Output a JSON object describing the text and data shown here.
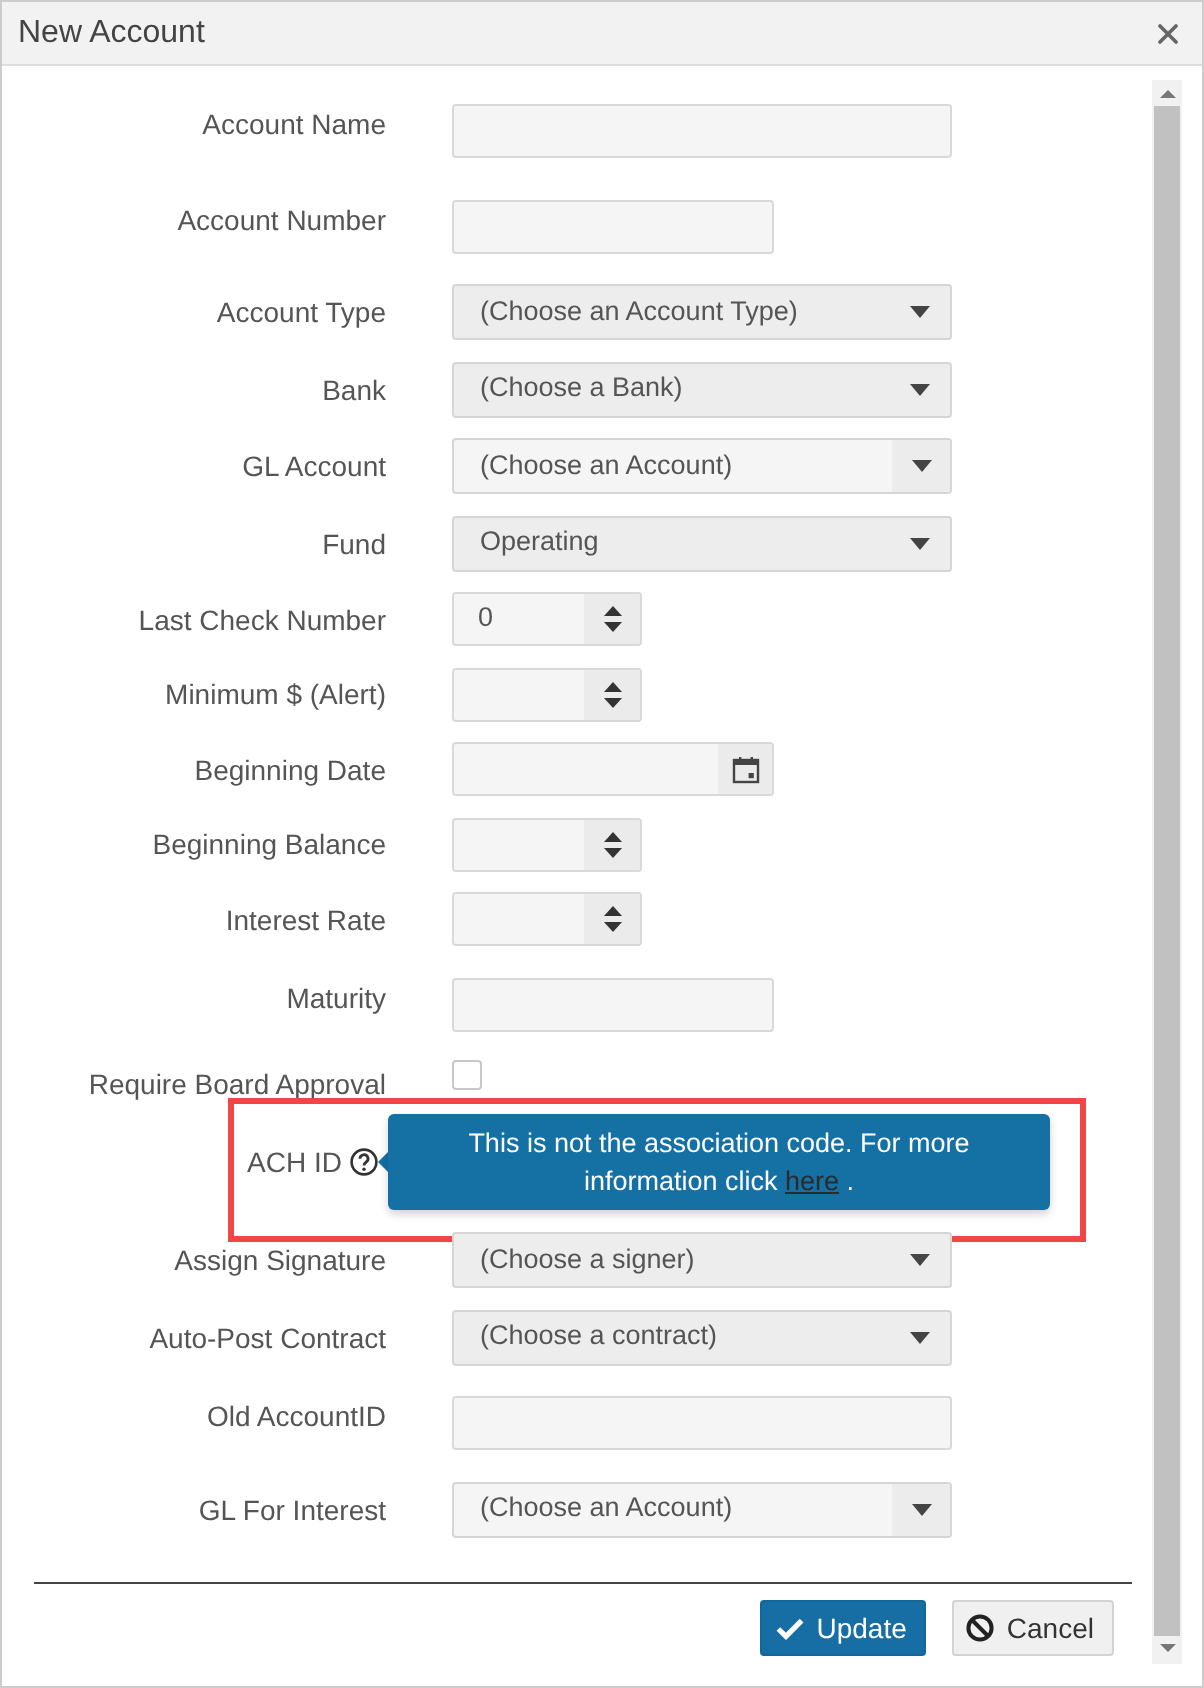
{
  "dialog": {
    "title": "New Account"
  },
  "fields": [
    {
      "label": "Account Name",
      "kind": "text"
    },
    {
      "label": "Account Number",
      "kind": "short-text"
    },
    {
      "label": "Account Type",
      "kind": "select",
      "value": "(Choose an Account Type)"
    },
    {
      "label": "Bank",
      "kind": "select",
      "value": "(Choose a Bank)"
    },
    {
      "label": "GL Account",
      "kind": "combo",
      "value": "(Choose an Account)"
    },
    {
      "label": "Fund",
      "kind": "select",
      "value": "Operating"
    },
    {
      "label": "Last Check Number",
      "kind": "number",
      "value": "0"
    },
    {
      "label": "Minimum $ (Alert)",
      "kind": "number"
    },
    {
      "label": "Beginning Date",
      "kind": "date"
    },
    {
      "label": "Beginning Balance",
      "kind": "number"
    },
    {
      "label": "Interest Rate",
      "kind": "number"
    },
    {
      "label": "Maturity",
      "kind": "short-text"
    },
    {
      "label": "Require Board Approval",
      "kind": "checkbox",
      "checked": false
    },
    {
      "label": "ACH ID",
      "kind": "help",
      "highlighted": true,
      "tooltip": {
        "text": "This is not the association code. For more information click",
        "link": "here",
        "after": "."
      }
    },
    {
      "label": "Assign Signature",
      "kind": "select",
      "value": "(Choose a signer)"
    },
    {
      "label": "Auto-Post Contract",
      "kind": "select",
      "value": "(Choose a contract)"
    },
    {
      "label": "Old AccountID",
      "kind": "text"
    },
    {
      "label": "GL For Interest",
      "kind": "combo",
      "value": "(Choose an Account)"
    }
  ],
  "buttons": [
    {
      "label": "Update",
      "kind": "primary"
    },
    {
      "label": "Cancel",
      "kind": "cancel"
    }
  ]
}
